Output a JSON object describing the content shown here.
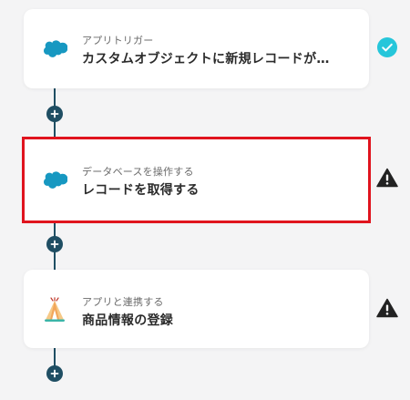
{
  "steps": [
    {
      "sub_label": "アプリトリガー",
      "title": "カスタムオブジェクトに新規レコードが…",
      "app_icon": "salesforce-cloud-icon",
      "status": "complete",
      "status_icon": "check-circle-icon"
    },
    {
      "sub_label": "データベースを操作する",
      "title": "レコードを取得する",
      "app_icon": "salesforce-cloud-icon",
      "status": "warning",
      "status_icon": "warning-triangle-icon"
    },
    {
      "sub_label": "アプリと連携する",
      "title": "商品情報の登録",
      "app_icon": "tent-app-icon",
      "status": "warning",
      "status_icon": "warning-triangle-icon"
    }
  ],
  "add_step_icon": "plus-icon",
  "colors": {
    "background": "#f4f4f5",
    "connector": "#1f4e63",
    "complete": "#26c6da",
    "warning": "#222222",
    "selection": "#e0141e",
    "salesforce": "#1798c1"
  }
}
